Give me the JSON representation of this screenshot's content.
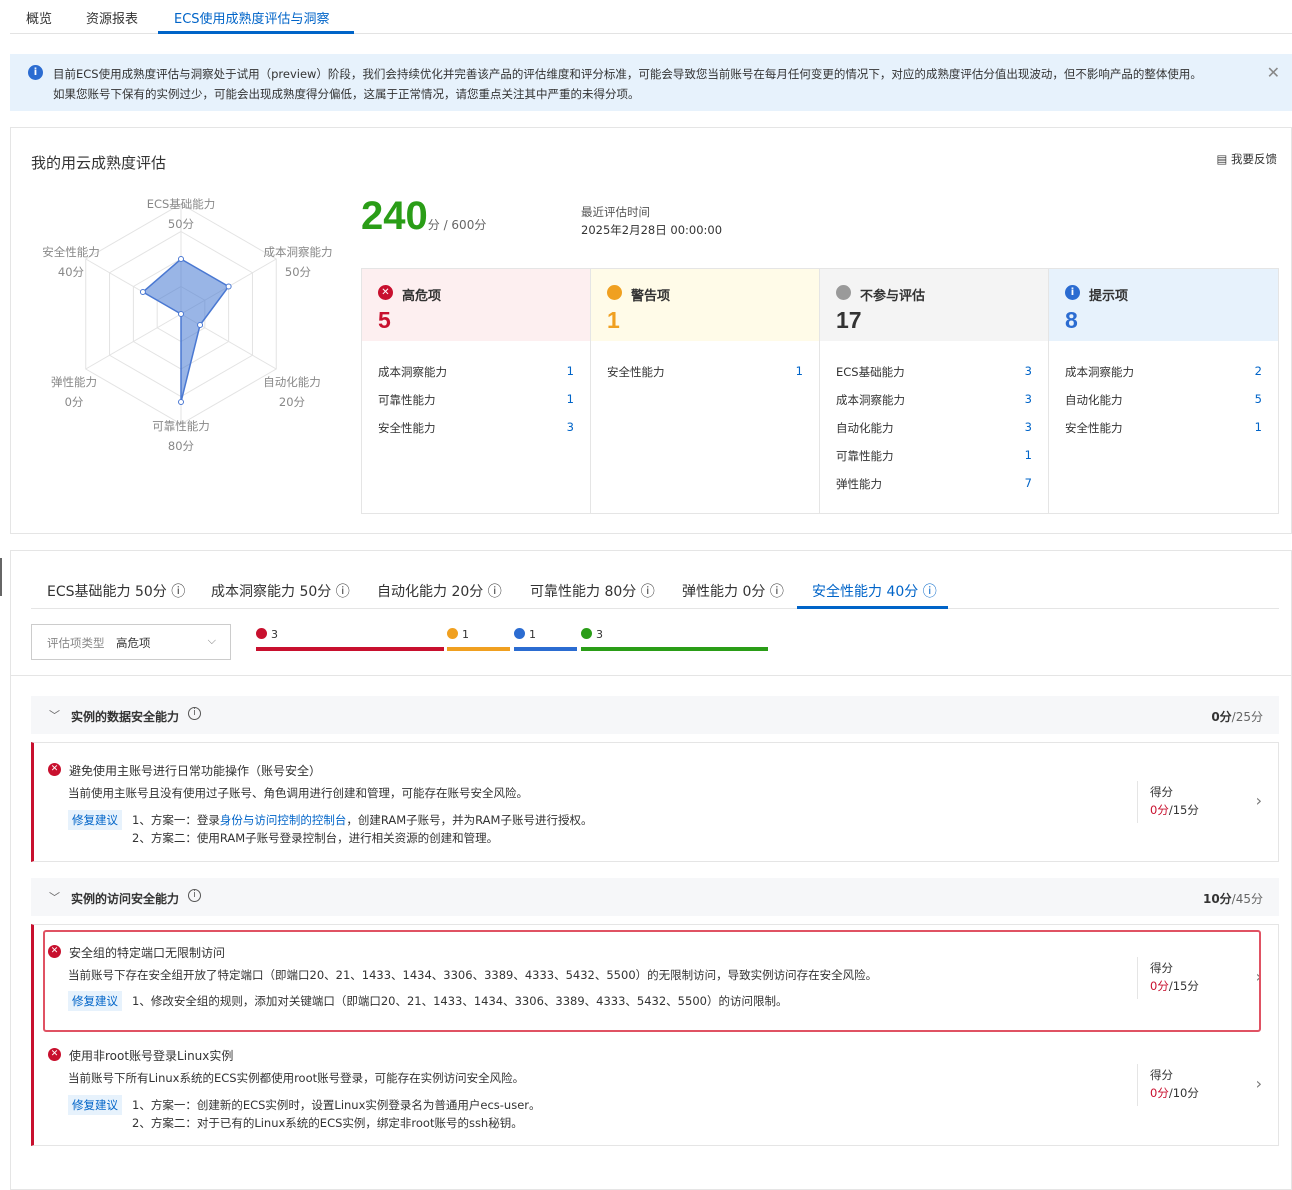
{
  "nav": {
    "tabs": [
      "概览",
      "资源报表",
      "ECS使用成熟度评估与洞察"
    ],
    "active": 2
  },
  "notice": {
    "line1": "目前ECS使用成熟度评估与洞察处于试用（preview）阶段，我们会持续优化并完善该产品的评估维度和评分标准，可能会导致您当前账号在每月任何变更的情况下，对应的成熟度评估分值出现波动，但不影响产品的整体使用。",
    "line2": "如果您账号下保有的实例过少，可能会出现成熟度得分偏低，这属于正常情况，请您重点关注其中严重的未得分项。",
    "info_icon": "info-icon",
    "close_icon": "close-icon"
  },
  "summary": {
    "title": "我的用云成熟度评估",
    "feedback": "我要反馈",
    "radar": [
      {
        "name": "ECS基础能力",
        "score": "50分",
        "value": 50,
        "max": 100
      },
      {
        "name": "成本洞察能力",
        "score": "50分",
        "value": 50,
        "max": 100
      },
      {
        "name": "自动化能力",
        "score": "20分",
        "value": 20,
        "max": 100
      },
      {
        "name": "可靠性能力",
        "score": "80分",
        "value": 80,
        "max": 100
      },
      {
        "name": "弹性能力",
        "score": "0分",
        "value": 0,
        "max": 100
      },
      {
        "name": "安全性能力",
        "score": "40分",
        "value": 40,
        "max": 100
      }
    ],
    "total": "240",
    "total_unit": "分 / 600分",
    "eval_label": "最近评估时间",
    "eval_date": "2025年2月28日 00:00:00",
    "columns": [
      {
        "label": "高危项",
        "count": "5",
        "color": "#c8102e",
        "bg": "#fdeff0",
        "icon": "x-circle-icon",
        "rows": [
          {
            "name": "成本洞察能力",
            "v": "1"
          },
          {
            "name": "可靠性能力",
            "v": "1"
          },
          {
            "name": "安全性能力",
            "v": "3"
          }
        ]
      },
      {
        "label": "警告项",
        "count": "1",
        "color": "#f0a020",
        "bg": "#fffbe8",
        "icon": "warning-circle-icon",
        "rows": [
          {
            "name": "安全性能力",
            "v": "1"
          }
        ]
      },
      {
        "label": "不参与评估",
        "count": "17",
        "color": "#333333",
        "bg": "#f4f4f4",
        "icon": "gray-circle-icon",
        "rows": [
          {
            "name": "ECS基础能力",
            "v": "3"
          },
          {
            "name": "成本洞察能力",
            "v": "3"
          },
          {
            "name": "自动化能力",
            "v": "3"
          },
          {
            "name": "可靠性能力",
            "v": "1"
          },
          {
            "name": "弹性能力",
            "v": "7"
          }
        ]
      },
      {
        "label": "提示项",
        "count": "8",
        "color": "#2b6cd1",
        "bg": "#e7f2fc",
        "icon": "info-circle-icon",
        "rows": [
          {
            "name": "成本洞察能力",
            "v": "2"
          },
          {
            "name": "自动化能力",
            "v": "5"
          },
          {
            "name": "安全性能力",
            "v": "1"
          }
        ]
      }
    ]
  },
  "detail": {
    "tabs": [
      "ECS基础能力 50分",
      "成本洞察能力 50分",
      "自动化能力 20分",
      "可靠性能力 80分",
      "弹性能力 0分",
      "安全性能力 40分"
    ],
    "active_tab": 5,
    "filter": {
      "label": "评估项类型",
      "value": "高危项"
    },
    "bars": [
      {
        "count": "3",
        "color": "#c8102e"
      },
      {
        "count": "1",
        "color": "#f0a020"
      },
      {
        "count": "1",
        "color": "#2b6cd1"
      },
      {
        "count": "3",
        "color": "#2a9d17"
      }
    ],
    "sections": [
      {
        "title": "实例的数据安全能力",
        "score": "0分",
        "total": "/25分",
        "items": [
          {
            "title": "避免使用主账号进行日常功能操作（账号安全）",
            "desc": "当前使用主账号且没有使用过子账号、角色调用进行创建和管理，可能存在账号安全风险。",
            "fix_label": "修复建议",
            "fix1_pre": "1、方案一：登录",
            "fix1_link": "身份与访问控制的控制台",
            "fix1_post": "，创建RAM子账号，并为RAM子账号进行授权。",
            "fix2": "2、方案二：使用RAM子账号登录控制台，进行相关资源的创建和管理。",
            "score_label": "得分",
            "score": "0分",
            "score_total": "/15分"
          }
        ]
      },
      {
        "title": "实例的访问安全能力",
        "score": "10分",
        "total": "/45分",
        "items": [
          {
            "title": "安全组的特定端口无限制访问",
            "desc": "当前账号下存在安全组开放了特定端口（即端口20、21、1433、1434、3306、3389、4333、5432、5500）的无限制访问，导致实例访问存在安全风险。",
            "fix_label": "修复建议",
            "fix1_pre": "1、修改安全组的规则，添加对关键端口（即端口20、21、1433、1434、3306、3389、4333、5432、5500）的访问限制。",
            "fix1_link": "",
            "fix1_post": "",
            "fix2": "",
            "score_label": "得分",
            "score": "0分",
            "score_total": "/15分"
          },
          {
            "title": "使用非root账号登录Linux实例",
            "desc": "当前账号下所有Linux系统的ECS实例都使用root账号登录，可能存在实例访问安全风险。",
            "fix_label": "修复建议",
            "fix1_pre": "1、方案一：创建新的ECS实例时，设置Linux实例登录名为普通用户ecs-user。",
            "fix1_link": "",
            "fix1_post": "",
            "fix2": "2、方案二：对于已有的Linux系统的ECS实例，绑定非root账号的ssh秘钥。",
            "score_label": "得分",
            "score": "0分",
            "score_total": "/10分"
          }
        ]
      }
    ]
  }
}
